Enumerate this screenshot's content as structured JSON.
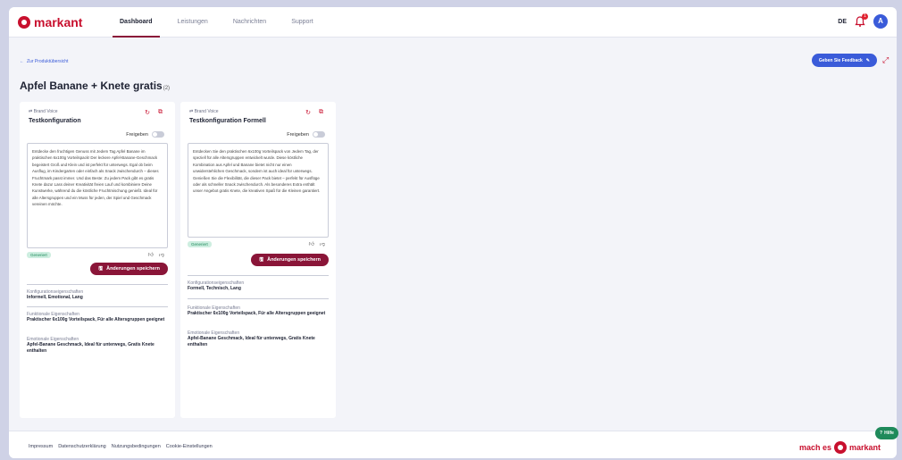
{
  "app": {
    "logo_text": "markant"
  },
  "nav": {
    "items": [
      {
        "label": "Dashboard",
        "active": true
      },
      {
        "label": "Leistungen",
        "active": false
      },
      {
        "label": "Nachrichten",
        "active": false
      },
      {
        "label": "Support",
        "active": false
      }
    ]
  },
  "topbar": {
    "lang": "DE",
    "notification_count": "1",
    "avatar_initial": "A"
  },
  "page": {
    "back_link": "Zur Produktübersicht",
    "feedback_button": "Geben Sie Feedback",
    "title": "Apfel Banane + Knete gratis",
    "title_suffix": "(2)"
  },
  "cards": [
    {
      "kicker": "Brand Voice",
      "title": "Testkonfiguration",
      "release_label": "Freigeben",
      "text": "Entdecke den fruchtigen Genuss mit Jedem Tag Apfel Banane im praktischen 6x100g Vorteilspack! Der leckere Apfel-Banane-Geschmack begeistert Groß und Klein und ist perfekt für unterwegs. Egal ob beim Ausflug, im Kindergarten oder einfach als Snack zwischendurch – dieses Fruchtmark passt immer. Und das Beste: Zu jedem Pack gibt es gratis Knete dazu! Lass deiner Kreativität freien Lauf und kombiniere Deine Kunstwerke, während du die köstliche Fruchtmischung genießt. Ideal für alle Altersgruppen und ein Muss für jeden, der Spiel und Geschmack vereinen möchte.",
      "badge": "Generiert",
      "save_button": "Änderungen speichern",
      "props": [
        {
          "label": "Konfigurationseigenschaften",
          "value": "Informell, Emotional, Lang"
        },
        {
          "label": "Funktionale Eigenschaften",
          "value": "Praktischer 6x100g Vorteilspack, Für alle Altersgruppen geeignet"
        },
        {
          "label": "Emotionale Eigenschaften",
          "value": "Apfel-Banane Geschmack, Ideal für unterwegs, Gratis Knete enthalten"
        }
      ]
    },
    {
      "kicker": "Brand Voice",
      "title": "Testkonfiguration Formell",
      "release_label": "Freigeben",
      "text": "Entdecken Sie den praktischen 6x100g Vorteilspack von Jedem Tag, der speziell für alle Altersgruppen entwickelt wurde. Diese köstliche Kombination aus Apfel und Banane bietet nicht nur einen unwiderstehlichen Geschmack, sondern ist auch ideal für unterwegs. Genießen Sie die Flexibilität, die dieser Pack bietet – perfekt für Ausflüge oder als schneller Snack zwischendurch. Als besonderes Extra enthält unser Angebot gratis Knete, die kreativen Spaß für die Kleinen garantiert.",
      "badge": "Generiert",
      "save_button": "Änderungen speichern",
      "props": [
        {
          "label": "Konfigurationseigenschaften",
          "value": "Formell, Technisch, Lang"
        },
        {
          "label": "Funktionale Eigenschaften",
          "value": "Praktischer 6x100g Vorteilspack, Für alle Altersgruppen geeignet"
        },
        {
          "label": "Emotionale Eigenschaften",
          "value": "Apfel-Banane Geschmack, Ideal für unterwegs, Gratis Knete enthalten"
        }
      ]
    }
  ],
  "footer": {
    "links": [
      "Impressum",
      "Datenschutzerklärung",
      "Nutzungsbedingungen",
      "Cookie-Einstellungen"
    ],
    "brand_prefix": "mach es",
    "brand_name": "markant",
    "help_button": "Hilfe"
  },
  "colors": {
    "brand": "#c8102e",
    "primary_button": "#8a1538",
    "accent": "#3a5bd9",
    "success": "#1f8a5b"
  }
}
